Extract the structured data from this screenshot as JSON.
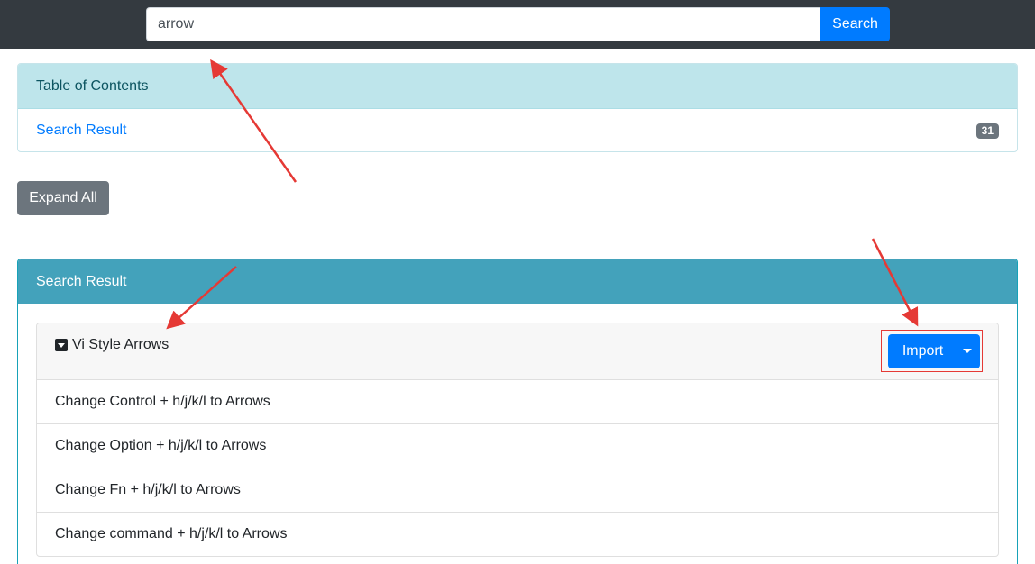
{
  "search": {
    "value": "arrow",
    "button_label": "Search"
  },
  "toc": {
    "header": "Table of Contents",
    "link_label": "Search Result",
    "count": "31"
  },
  "expand_all_label": "Expand All",
  "results": {
    "header": "Search Result",
    "group_title": "Vi Style Arrows",
    "import_label": "Import",
    "items": [
      "Change Control + h/j/k/l to Arrows",
      "Change Option + h/j/k/l to Arrows",
      "Change Fn + h/j/k/l to Arrows",
      "Change command + h/j/k/l to Arrows"
    ]
  },
  "colors": {
    "navbar": "#343a40",
    "primary": "#007bff",
    "info": "#43a2bb",
    "toc_header": "#bee5eb",
    "secondary": "#6c757d",
    "annotation": "#e53935"
  }
}
